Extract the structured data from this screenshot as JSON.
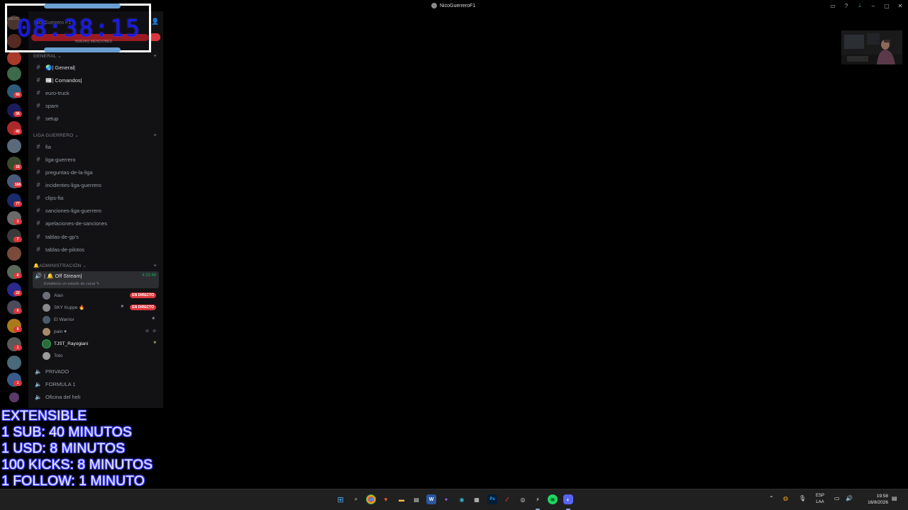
{
  "window": {
    "title": "NicoGuerreroF1"
  },
  "clock_overlay": {
    "time": "08:38:15",
    "faint_server_name": "NicoGuerrero F1",
    "faint_new_label": "NUEVO",
    "faint_bar_text": "NUEVAS MENCIONES"
  },
  "sidebar": {
    "categories": {
      "general": "GENERAL",
      "liga": "LIGA GUERRERO",
      "admin": "ADMINISTRACIÓN"
    },
    "general_channels": [
      {
        "icon": "🌏",
        "label": "| General|"
      },
      {
        "icon": "📰",
        "label": "| Comandos|"
      },
      {
        "label": "euro-truck"
      },
      {
        "label": "spam"
      },
      {
        "label": "setup"
      }
    ],
    "liga_channels": [
      {
        "label": "fia"
      },
      {
        "label": "liga-guerrero"
      },
      {
        "label": "preguntas-de-la-liga"
      },
      {
        "label": "incidentes-liga-guerrero"
      },
      {
        "label": "clips-fia"
      },
      {
        "label": "sanciones-liga-guerrero"
      },
      {
        "label": "apelaciones-de-sanciones"
      },
      {
        "label": "tablas-de-gp's"
      },
      {
        "label": "tablas-de-pilotos"
      }
    ],
    "admin_voice": {
      "label": "| 🔔 Off Stream|",
      "timer": "4:33:48",
      "status": "Establece un estado de canal"
    },
    "voice_users": [
      {
        "name": "Alan",
        "live": "EN DIRECTO",
        "avatar_color": "#6d6f78"
      },
      {
        "name": "SKY Kuppe 🔥",
        "live": "EN DIRECTO",
        "avatar_color": "#8a8a8a"
      },
      {
        "name": "El Warrior",
        "avatar_color": "#4a5a6a"
      },
      {
        "name": "pain ♥",
        "avatar_color": "#a88a6a"
      },
      {
        "name": "TJST_Rayogiani",
        "avatar_color": "#2f6b3a"
      },
      {
        "name": "Toto",
        "avatar_color": "#9a9a9a"
      }
    ],
    "other_voice": [
      {
        "label": "PRIVADO"
      },
      {
        "label": "FORMULA 1"
      },
      {
        "label": "Oficina del heli"
      }
    ]
  },
  "server_badges": [
    "60",
    "56",
    "42",
    "16",
    "168",
    "77",
    "3",
    "7",
    "8",
    "22",
    "6",
    "8",
    "1",
    "1"
  ],
  "promo": {
    "lines": [
      "EXTENSIBLE",
      "1 SUB: 40 MINUTOS",
      "1 USD: 8 MINUTOS",
      "100 KICKS: 8 MINUTOS",
      "1 FOLLOW: 1 MINUTO"
    ]
  },
  "taskbar": {
    "lang_top": "ESP",
    "lang_bottom": "LAA",
    "time": "19:58",
    "date": "16/8/2026"
  },
  "colors": {
    "clock_text": "#1818e8",
    "live_badge": "#da373c",
    "voice_green": "#23a559",
    "promo_outline": "#4848ff"
  }
}
